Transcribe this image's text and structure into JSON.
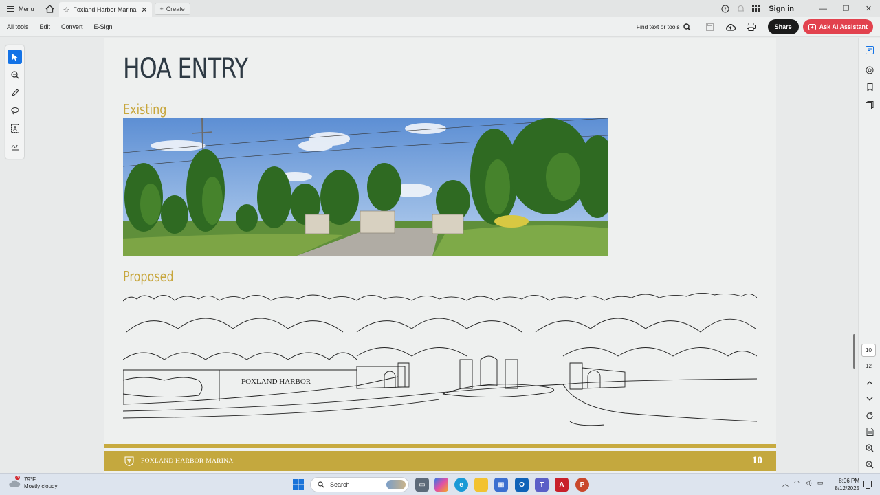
{
  "titlebar": {
    "menu_label": "Menu",
    "tab_title": "Foxland Harbor Marina ...",
    "create_label": "Create",
    "signin_label": "Sign in"
  },
  "toolbar": {
    "items": [
      "All tools",
      "Edit",
      "Convert",
      "E-Sign"
    ],
    "find_label": "Find text or tools",
    "share_label": "Share",
    "ai_label": "Ask AI Assistant"
  },
  "document": {
    "title": "HOA ENTRY",
    "existing_label": "Existing",
    "proposed_label": "Proposed",
    "sketch_sign_text": "FOXLAND HARBOR",
    "footer_text": "FOXLAND HARBOR MARINA",
    "page_number": "10"
  },
  "navigation": {
    "current_page": "10",
    "total_pages": "12"
  },
  "taskbar": {
    "weather_temp": "79°F",
    "weather_desc": "Mostly cloudy",
    "weather_badge": "3",
    "search_label": "Search",
    "time": "8:06 PM",
    "date": "8/12/2025"
  },
  "colors": {
    "gold": "#c4a83e",
    "title": "#2e3a44",
    "accent_blue": "#1473e6",
    "ai_red": "#e2424e"
  }
}
